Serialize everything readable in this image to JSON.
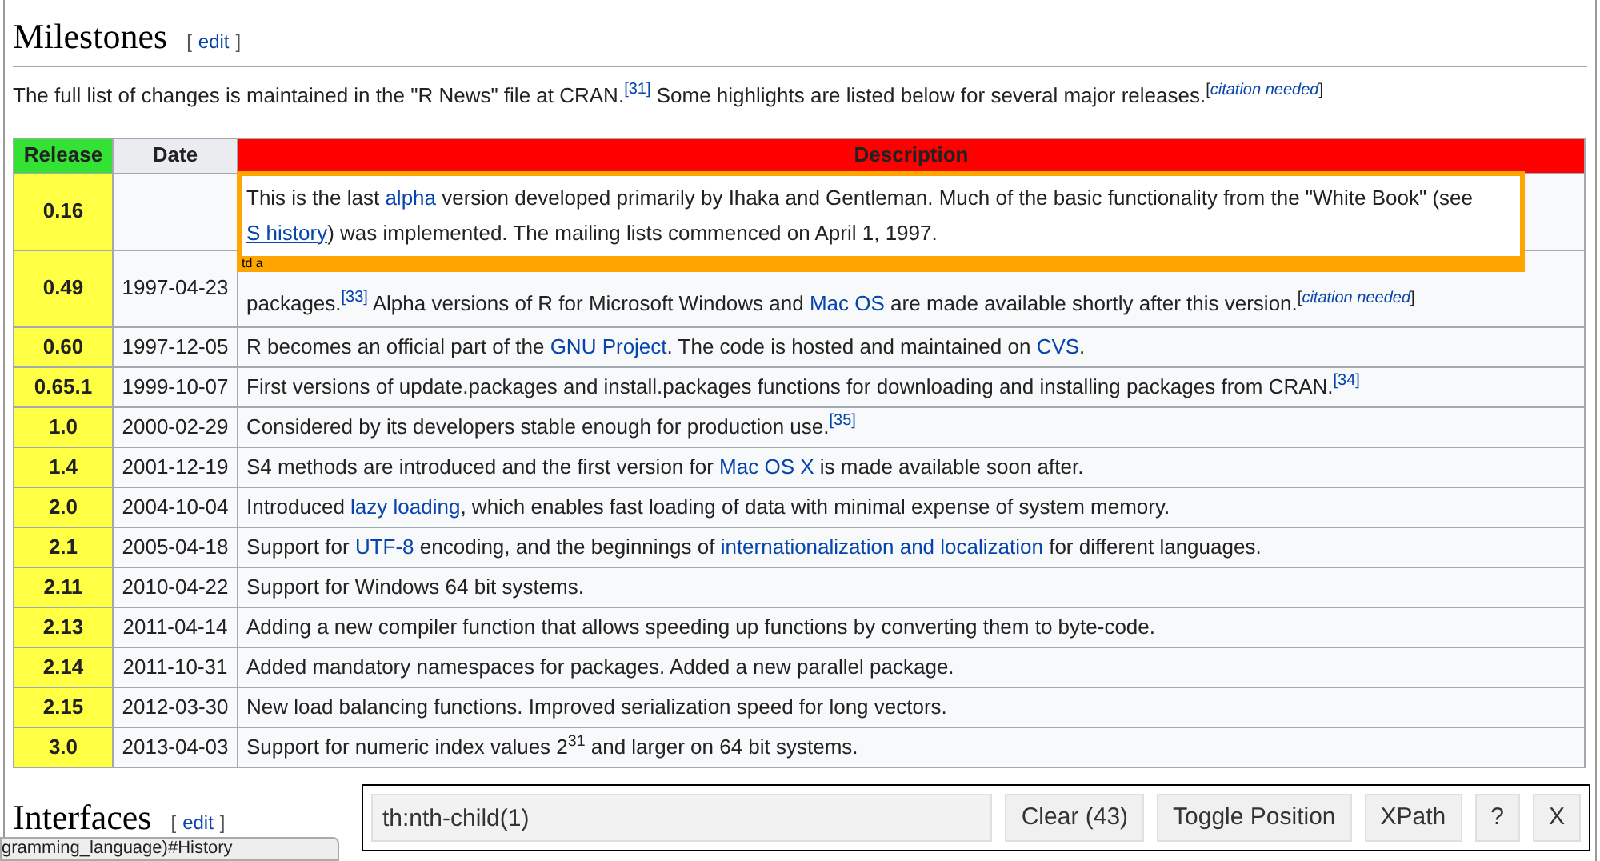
{
  "section": {
    "title": "Milestones",
    "edit": {
      "open": "[",
      "label": "edit",
      "close": "]"
    }
  },
  "intro": [
    {
      "kind": "text",
      "text": "The full list of changes is maintained in the \"R News\" file at CRAN."
    },
    {
      "kind": "ref",
      "text": "[31]"
    },
    {
      "kind": "text",
      "text": " Some highlights are listed below for several major releases."
    },
    {
      "kind": "note",
      "open": "[",
      "text": "citation needed",
      "close": "]"
    }
  ],
  "table": {
    "columns": [
      {
        "label": "Release",
        "color": "#33e233"
      },
      {
        "label": "Date",
        "color": "#eaecf0"
      },
      {
        "label": "Description",
        "color": "#ff0000"
      }
    ],
    "rows": [
      {
        "release": "0.16",
        "date": "",
        "highlighted": true,
        "description": [
          {
            "kind": "text",
            "text": "This is the last "
          },
          {
            "kind": "link",
            "text": "alpha"
          },
          {
            "kind": "text",
            "text": " version developed primarily by Ihaka and Gentleman. Much of the basic functionality from the \"White Book\" (see "
          },
          {
            "kind": "link",
            "text": "S history",
            "underline": true
          },
          {
            "kind": "text",
            "text": ") was implemented. The mailing lists commenced on April 1, 1997."
          }
        ]
      },
      {
        "release": "0.49",
        "date": "1997-04-23",
        "highlighted": false,
        "description": [
          {
            "kind": "text",
            "text": "packages."
          },
          {
            "kind": "ref",
            "text": "[33]"
          },
          {
            "kind": "text",
            "text": " Alpha versions of R for Microsoft Windows and "
          },
          {
            "kind": "link",
            "text": "Mac OS"
          },
          {
            "kind": "text",
            "text": " are made available shortly after this version."
          },
          {
            "kind": "note",
            "open": "[",
            "text": "citation needed",
            "close": "]"
          }
        ]
      },
      {
        "release": "0.60",
        "date": "1997-12-05",
        "highlighted": false,
        "description": [
          {
            "kind": "text",
            "text": "R becomes an official part of the "
          },
          {
            "kind": "link",
            "text": "GNU Project"
          },
          {
            "kind": "text",
            "text": ". The code is hosted and maintained on "
          },
          {
            "kind": "link",
            "text": "CVS"
          },
          {
            "kind": "text",
            "text": "."
          }
        ]
      },
      {
        "release": "0.65.1",
        "date": "1999-10-07",
        "highlighted": false,
        "description": [
          {
            "kind": "text",
            "text": "First versions of update.packages and install.packages functions for downloading and installing packages from CRAN."
          },
          {
            "kind": "ref",
            "text": "[34]"
          }
        ]
      },
      {
        "release": "1.0",
        "date": "2000-02-29",
        "highlighted": false,
        "description": [
          {
            "kind": "text",
            "text": "Considered by its developers stable enough for production use."
          },
          {
            "kind": "ref",
            "text": "[35]"
          }
        ]
      },
      {
        "release": "1.4",
        "date": "2001-12-19",
        "highlighted": false,
        "description": [
          {
            "kind": "text",
            "text": "S4 methods are introduced and the first version for "
          },
          {
            "kind": "link",
            "text": "Mac OS X"
          },
          {
            "kind": "text",
            "text": " is made available soon after."
          }
        ]
      },
      {
        "release": "2.0",
        "date": "2004-10-04",
        "highlighted": false,
        "description": [
          {
            "kind": "text",
            "text": "Introduced "
          },
          {
            "kind": "link",
            "text": "lazy loading"
          },
          {
            "kind": "text",
            "text": ", which enables fast loading of data with minimal expense of system memory."
          }
        ]
      },
      {
        "release": "2.1",
        "date": "2005-04-18",
        "highlighted": false,
        "description": [
          {
            "kind": "text",
            "text": "Support for "
          },
          {
            "kind": "link",
            "text": "UTF-8"
          },
          {
            "kind": "text",
            "text": " encoding, and the beginnings of "
          },
          {
            "kind": "link",
            "text": "internationalization and localization"
          },
          {
            "kind": "text",
            "text": " for different languages."
          }
        ]
      },
      {
        "release": "2.11",
        "date": "2010-04-22",
        "highlighted": false,
        "description": [
          {
            "kind": "text",
            "text": "Support for Windows 64 bit systems."
          }
        ]
      },
      {
        "release": "2.13",
        "date": "2011-04-14",
        "highlighted": false,
        "description": [
          {
            "kind": "text",
            "text": "Adding a new compiler function that allows speeding up functions by converting them to byte-code."
          }
        ]
      },
      {
        "release": "2.14",
        "date": "2011-10-31",
        "highlighted": false,
        "description": [
          {
            "kind": "text",
            "text": "Added mandatory namespaces for packages. Added a new parallel package."
          }
        ]
      },
      {
        "release": "2.15",
        "date": "2012-03-30",
        "highlighted": false,
        "description": [
          {
            "kind": "text",
            "text": "New load balancing functions. Improved serialization speed for long vectors."
          }
        ]
      },
      {
        "release": "3.0",
        "date": "2013-04-03",
        "highlighted": false,
        "description": [
          {
            "kind": "text",
            "text": "Support for numeric index values 2$^{31}$ and larger on 64 bit systems."
          }
        ]
      }
    ]
  },
  "overlay": {
    "label": "td a"
  },
  "next_section": {
    "title": "Interfaces",
    "edit": {
      "open": "[",
      "label": "edit",
      "close": "]"
    }
  },
  "selector_bar": {
    "value": "th:nth-child(1)",
    "buttons": [
      "Clear (43)",
      "Toggle Position",
      "XPath",
      "?",
      "X"
    ]
  },
  "status_url": "gramming_language)#History"
}
